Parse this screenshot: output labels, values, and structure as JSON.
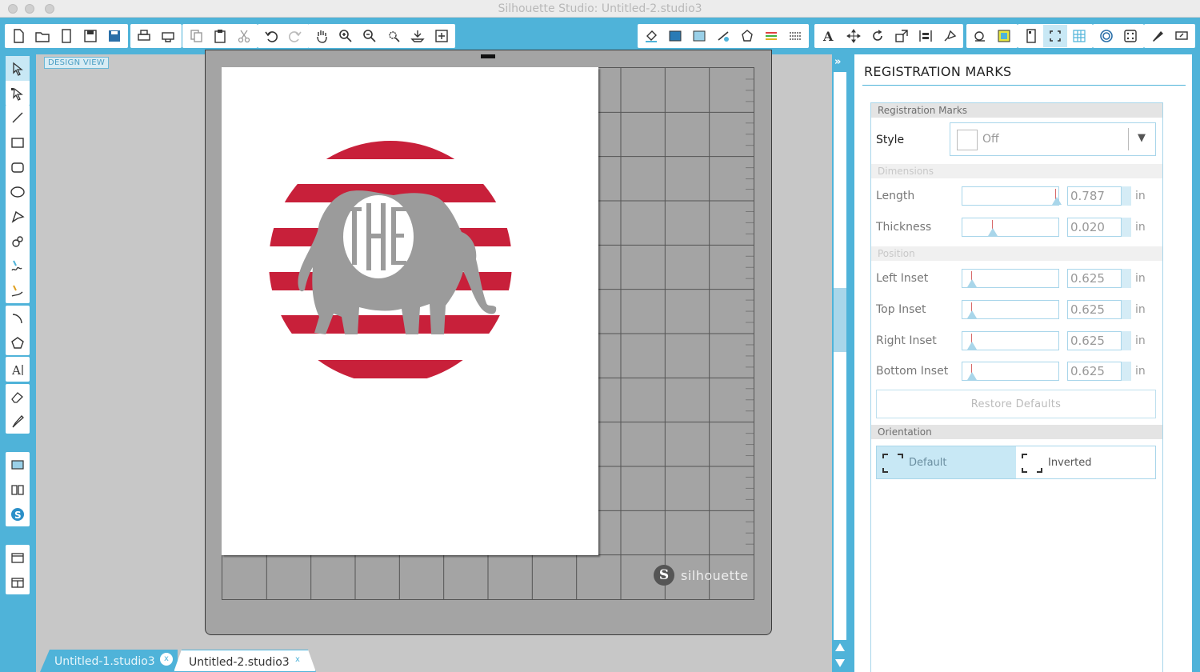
{
  "window": {
    "title": "Silhouette Studio: Untitled-2.studio3"
  },
  "canvas": {
    "design_view_label": "DESIGN VIEW",
    "brand": "silhouette",
    "artwork": {
      "monogram": "THE",
      "stripe_color": "#c8203a",
      "elephant_color": "#9b9b9b"
    }
  },
  "panel": {
    "title": "REGISTRATION MARKS",
    "section_registration": "Registration Marks",
    "style": {
      "label": "Style",
      "value": "Off"
    },
    "section_dimensions": "Dimensions",
    "length": {
      "label": "Length",
      "value": "0.787",
      "unit": "in"
    },
    "thickness": {
      "label": "Thickness",
      "value": "0.020",
      "unit": "in"
    },
    "section_position": "Position",
    "left_inset": {
      "label": "Left Inset",
      "value": "0.625",
      "unit": "in"
    },
    "top_inset": {
      "label": "Top Inset",
      "value": "0.625",
      "unit": "in"
    },
    "right_inset": {
      "label": "Right Inset",
      "value": "0.625",
      "unit": "in"
    },
    "bottom_inset": {
      "label": "Bottom Inset",
      "value": "0.625",
      "unit": "in"
    },
    "restore_defaults": "Restore Defaults",
    "section_orientation": "Orientation",
    "orientation_default": "Default",
    "orientation_inverted": "Inverted"
  },
  "tabs": [
    {
      "label": "Untitled-1.studio3",
      "close": "x"
    },
    {
      "label": "Untitled-2.studio3",
      "close": "x"
    }
  ],
  "colors": {
    "accent": "#4fb3d9"
  }
}
